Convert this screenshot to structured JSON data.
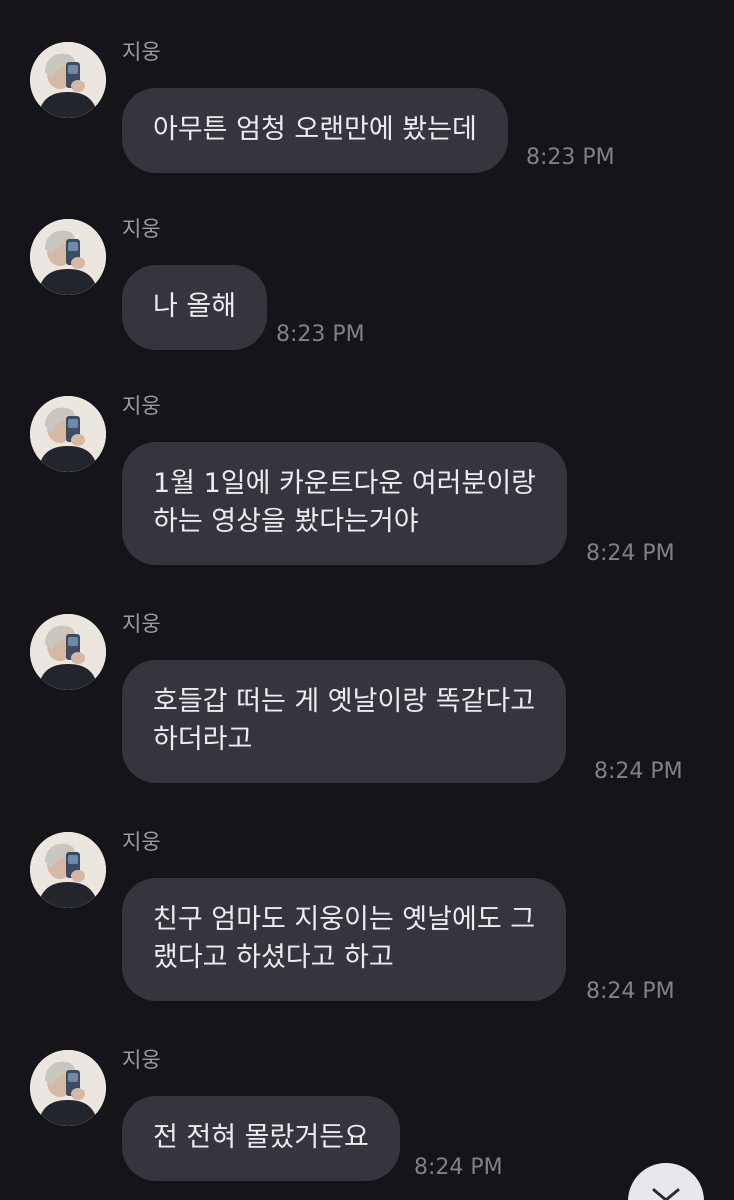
{
  "conversation": {
    "messages": [
      {
        "sender": "지웅",
        "lines": [
          "아무튼 엄청 오랜만에 봤는데"
        ],
        "time": "8:23 PM"
      },
      {
        "sender": "지웅",
        "lines": [
          "나 올해"
        ],
        "time": "8:23 PM"
      },
      {
        "sender": "지웅",
        "lines": [
          "1월 1일에 카운트다운 여러분이랑",
          "하는 영상을 봤다는거야"
        ],
        "time": "8:24 PM"
      },
      {
        "sender": "지웅",
        "lines": [
          "호들갑 떠는 게 옛날이랑 똑같다고",
          "하더라고"
        ],
        "time": "8:24 PM"
      },
      {
        "sender": "지웅",
        "lines": [
          "친구 엄마도 지웅이는 옛날에도 그",
          "랬다고 하셨다고 하고"
        ],
        "time": "8:24 PM"
      },
      {
        "sender": "지웅",
        "lines": [
          "전 전혀 몰랐거든요"
        ],
        "time": "8:24 PM"
      }
    ]
  },
  "colors": {
    "background": "#151519",
    "bubble": "#35363d",
    "text": "#ececf0",
    "sender": "#9a9aa2",
    "timestamp": "#7f8088"
  },
  "icons": {
    "scroll_down": "chevron-down-icon"
  }
}
